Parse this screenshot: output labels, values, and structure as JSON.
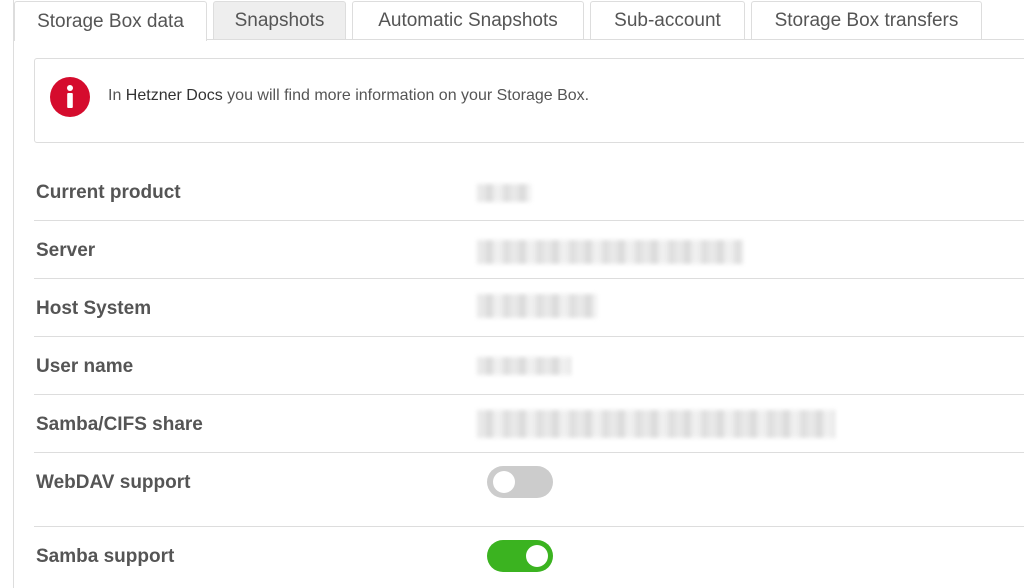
{
  "tabs": [
    {
      "label": "Storage Box data",
      "state": "active"
    },
    {
      "label": "Snapshots",
      "state": "hover"
    },
    {
      "label": "Automatic Snapshots",
      "state": "normal"
    },
    {
      "label": "Sub-account",
      "state": "normal"
    },
    {
      "label": "Storage Box transfers",
      "state": "normal"
    }
  ],
  "info": {
    "prefix": "In ",
    "link": "Hetzner Docs",
    "suffix": " you will find more information on your Storage Box.",
    "icon": "info-icon",
    "icon_color": "#d50c2d"
  },
  "details": {
    "current_product": {
      "label": "Current product",
      "value_redacted": true
    },
    "server": {
      "label": "Server",
      "value_redacted": true
    },
    "host_system": {
      "label": "Host System",
      "value_redacted": true
    },
    "user_name": {
      "label": "User name",
      "value_redacted": true
    },
    "samba_share": {
      "label": "Samba/CIFS share",
      "value_redacted": true
    },
    "webdav": {
      "label": "WebDAV support",
      "enabled": false
    },
    "samba": {
      "label": "Samba support",
      "enabled": true
    }
  },
  "colors": {
    "toggle_on": "#3bb320",
    "toggle_off": "#cccccc",
    "border": "#dddddd",
    "text": "#555555"
  }
}
